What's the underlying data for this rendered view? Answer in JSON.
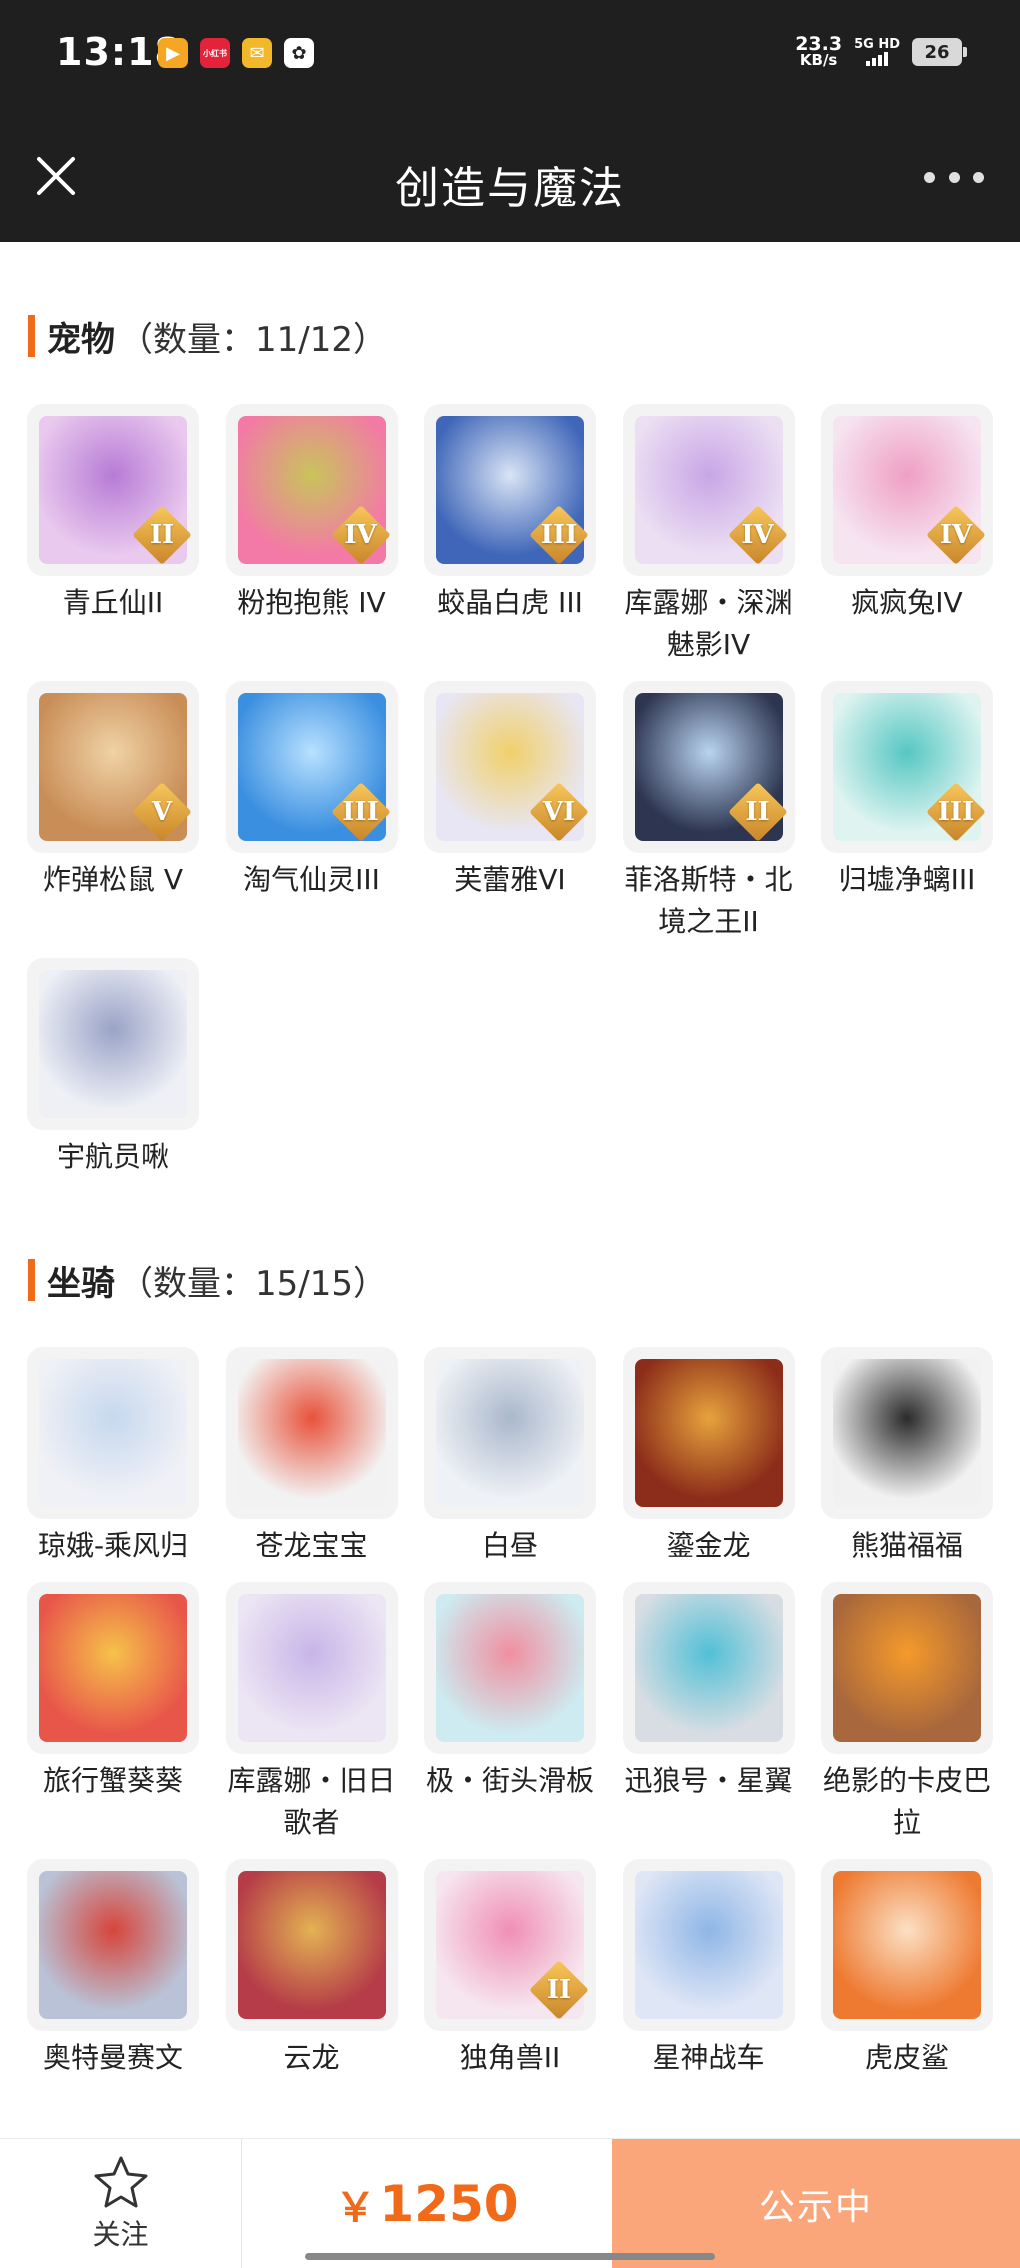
{
  "status_bar": {
    "time": "13:18",
    "net_speed_value": "23.3",
    "net_speed_unit": "KB/s",
    "network": "5G HD",
    "battery": "26",
    "app_icons": [
      {
        "name": "video-app-icon",
        "color": "#f5a623",
        "glyph": "▶"
      },
      {
        "name": "xiaohongshu-app-icon",
        "color": "#e4233b",
        "glyph": "小红书"
      },
      {
        "name": "mail-app-icon",
        "color": "#f3b82a",
        "glyph": "✉"
      },
      {
        "name": "game-app-icon",
        "color": "#ffffff",
        "glyph": "✿"
      }
    ]
  },
  "header": {
    "title": "创造与魔法"
  },
  "pets": {
    "name": "宠物",
    "count": "（数量：11/12）",
    "items": [
      {
        "label": "青丘仙II",
        "rank": "II",
        "bg": "#e9c9ee",
        "accent": "#b77bd6"
      },
      {
        "label": "粉抱抱熊 IV",
        "rank": "IV",
        "bg": "#f37aa6",
        "accent": "#c8c45a"
      },
      {
        "label": "蛟晶白虎 III",
        "rank": "III",
        "bg": "#3f66b8",
        "accent": "#d9e4f5"
      },
      {
        "label": "库露娜・深渊魅影IV",
        "rank": "IV",
        "bg": "#ecdff3",
        "accent": "#c8a6e6"
      },
      {
        "label": "疯疯兔IV",
        "rank": "IV",
        "bg": "#f6e4f1",
        "accent": "#ef9fc4"
      },
      {
        "label": "炸弹松鼠 V",
        "rank": "V",
        "bg": "#c98e57",
        "accent": "#f0d2a6"
      },
      {
        "label": "淘气仙灵III",
        "rank": "III",
        "bg": "#3b8fe0",
        "accent": "#b8e1ff"
      },
      {
        "label": "芙蕾雅VI",
        "rank": "VI",
        "bg": "#e8e6f4",
        "accent": "#f1d06a"
      },
      {
        "label": "菲洛斯特・北境之王II",
        "rank": "II",
        "bg": "#2d3550",
        "accent": "#b9d4f0"
      },
      {
        "label": "归墟净螭III",
        "rank": "III",
        "bg": "#dff4f1",
        "accent": "#56c7c2"
      },
      {
        "label": "宇航员啾",
        "rank": "",
        "bg": "#eef0f6",
        "accent": "#9aa3c7"
      }
    ]
  },
  "mounts": {
    "name": "坐骑",
    "count": "（数量：15/15）",
    "items": [
      {
        "label": "琼娥-乘风归",
        "rank": "",
        "bg": "#f0f1f6",
        "accent": "#c6d8ee"
      },
      {
        "label": "苍龙宝宝",
        "rank": "",
        "bg": "#f2f2f2",
        "accent": "#e8523a"
      },
      {
        "label": "白昼",
        "rank": "",
        "bg": "#eef1f5",
        "accent": "#aab8cc"
      },
      {
        "label": "鎏金龙",
        "rank": "",
        "bg": "#8c2c1a",
        "accent": "#e6a33c"
      },
      {
        "label": "熊猫福福",
        "rank": "",
        "bg": "#f1f1f1",
        "accent": "#2b2b2b"
      },
      {
        "label": "旅行蟹葵葵",
        "rank": "",
        "bg": "#e8564a",
        "accent": "#f6c24a"
      },
      {
        "label": "库露娜・旧日歌者",
        "rank": "",
        "bg": "#ece6f4",
        "accent": "#c8b5e8"
      },
      {
        "label": "极・街头滑板",
        "rank": "",
        "bg": "#cdebf0",
        "accent": "#f08fa0"
      },
      {
        "label": "迅狼号・星翼",
        "rank": "",
        "bg": "#d8dde3",
        "accent": "#51c0d6"
      },
      {
        "label": "绝影的卡皮巴拉",
        "rank": "",
        "bg": "#a8673c",
        "accent": "#f59a2b"
      },
      {
        "label": "奥特曼赛文",
        "rank": "",
        "bg": "#b9c2d6",
        "accent": "#d6453b"
      },
      {
        "label": "云龙",
        "rank": "",
        "bg": "#b53c48",
        "accent": "#e3b253"
      },
      {
        "label": "独角兽II",
        "rank": "II",
        "bg": "#f6e6ef",
        "accent": "#f08fb5"
      },
      {
        "label": "星神战车",
        "rank": "",
        "bg": "#dfe6f6",
        "accent": "#8fb6e6"
      },
      {
        "label": "虎皮鲨",
        "rank": "",
        "bg": "#ee7a32",
        "accent": "#fbe0c4"
      }
    ]
  },
  "footer": {
    "follow_label": "关注",
    "price_symbol": "￥",
    "price_value": "1250",
    "status_label": "公示中"
  }
}
